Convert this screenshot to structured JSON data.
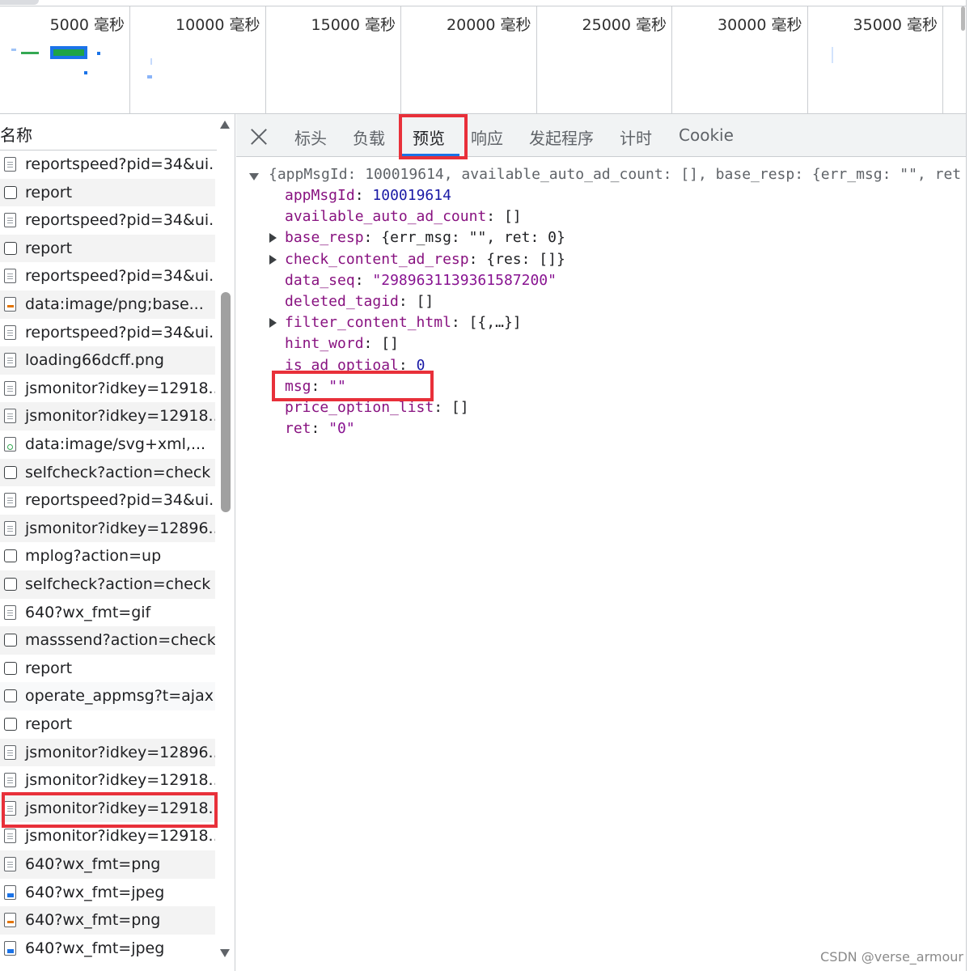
{
  "timeline": {
    "ticks": [
      "5000  毫秒",
      "10000  毫秒",
      "15000  毫秒",
      "20000  毫秒",
      "25000  毫秒",
      "30000  毫秒",
      "35000  毫秒"
    ]
  },
  "request_list": {
    "header": "名称",
    "rows": [
      {
        "name": "reportspeed?pid=34&ui...",
        "icon": "document-icon"
      },
      {
        "name": "report",
        "icon": "checkbox-icon"
      },
      {
        "name": "reportspeed?pid=34&ui...",
        "icon": "document-icon"
      },
      {
        "name": "report",
        "icon": "checkbox-icon"
      },
      {
        "name": "reportspeed?pid=34&ui...",
        "icon": "document-icon"
      },
      {
        "name": "data:image/png;base...",
        "icon": "png-file-icon"
      },
      {
        "name": "reportspeed?pid=34&ui...",
        "icon": "document-icon"
      },
      {
        "name": "loading66dcff.png",
        "icon": "document-icon"
      },
      {
        "name": "jsmonitor?idkey=12918...",
        "icon": "document-icon"
      },
      {
        "name": "jsmonitor?idkey=12918...",
        "icon": "document-icon"
      },
      {
        "name": "data:image/svg+xml,...",
        "icon": "svg-file-icon"
      },
      {
        "name": "selfcheck?action=check",
        "icon": "checkbox-icon"
      },
      {
        "name": "reportspeed?pid=34&ui...",
        "icon": "document-icon"
      },
      {
        "name": "jsmonitor?idkey=12896...",
        "icon": "document-icon"
      },
      {
        "name": "mplog?action=up",
        "icon": "checkbox-icon"
      },
      {
        "name": "selfcheck?action=check",
        "icon": "checkbox-icon"
      },
      {
        "name": "640?wx_fmt=gif",
        "icon": "document-icon"
      },
      {
        "name": "masssend?action=check...",
        "icon": "checkbox-icon"
      },
      {
        "name": "report",
        "icon": "checkbox-icon"
      },
      {
        "name": "operate_appmsg?t=ajax...",
        "icon": "checkbox-icon"
      },
      {
        "name": "report",
        "icon": "checkbox-icon"
      },
      {
        "name": "jsmonitor?idkey=12896...",
        "icon": "document-icon"
      },
      {
        "name": "jsmonitor?idkey=12918...",
        "icon": "document-icon"
      },
      {
        "name": "jsmonitor?idkey=12918...",
        "icon": "document-icon"
      },
      {
        "name": "jsmonitor?idkey=12918...",
        "icon": "document-icon"
      },
      {
        "name": "640?wx_fmt=png",
        "icon": "document-icon"
      },
      {
        "name": "640?wx_fmt=jpeg",
        "icon": "image-file-icon"
      },
      {
        "name": "640?wx_fmt=png",
        "icon": "png-file-icon"
      },
      {
        "name": "640?wx_fmt=jpeg",
        "icon": "image-file-icon"
      }
    ],
    "selected_row": "operate_appmsg?t=ajax..."
  },
  "detail": {
    "tabs": [
      "标头",
      "负载",
      "预览",
      "响应",
      "发起程序",
      "计时",
      "Cookie"
    ],
    "active_tab": "预览",
    "json_summary": "{appMsgId: 100019614, available_auto_ad_count: [], base_resp: {err_msg: \"\", ret",
    "fields": [
      {
        "key": "appMsgId",
        "value": "100019614",
        "kind": "number",
        "expandable": false
      },
      {
        "key": "available_auto_ad_count",
        "value": "[]",
        "kind": "plain",
        "expandable": false
      },
      {
        "key": "base_resp",
        "value": "{err_msg: \"\", ret: 0}",
        "kind": "plain",
        "expandable": true
      },
      {
        "key": "check_content_ad_resp",
        "value": "{res: []}",
        "kind": "plain",
        "expandable": true
      },
      {
        "key": "data_seq",
        "value": "\"2989631139361587200\"",
        "kind": "string",
        "expandable": false
      },
      {
        "key": "deleted_tagid",
        "value": "[]",
        "kind": "plain",
        "expandable": false
      },
      {
        "key": "filter_content_html",
        "value": "[{,…}]",
        "kind": "plain",
        "expandable": true
      },
      {
        "key": "hint_word",
        "value": "[]",
        "kind": "plain",
        "expandable": false
      },
      {
        "key": "is_ad_optioal",
        "value": "0",
        "kind": "number",
        "expandable": false
      },
      {
        "key": "msg",
        "value": "\"\"",
        "kind": "string",
        "expandable": false
      },
      {
        "key": "price_option_list",
        "value": "[]",
        "kind": "plain",
        "expandable": false
      },
      {
        "key": "ret",
        "value": "\"0\"",
        "kind": "string",
        "expandable": false
      }
    ]
  },
  "watermark": "CSDN @verse_armour",
  "colors": {
    "highlight_box": "#e8303a",
    "tab_active_underline": "#1a73e8",
    "json_key": "#881280",
    "json_number": "#1a1aa6",
    "json_string": "#c80000"
  }
}
